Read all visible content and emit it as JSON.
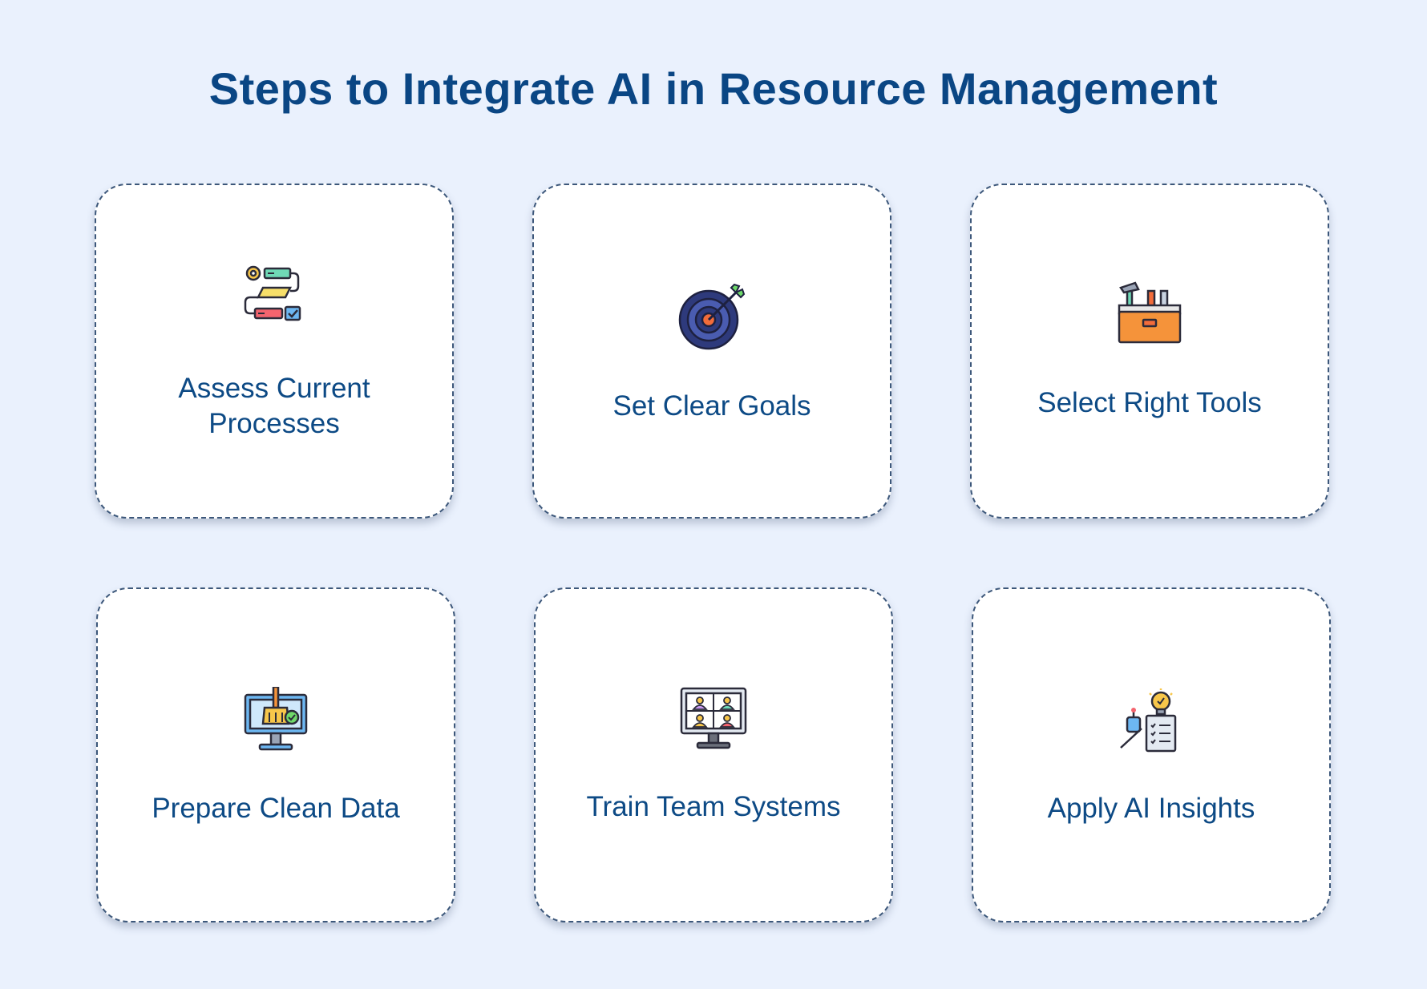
{
  "title": "Steps to Integrate AI in Resource Management",
  "colors": {
    "background": "#eaf1fd",
    "title": "#0a4684",
    "label": "#0d4a85",
    "card_border": "#3c577a"
  },
  "steps": [
    {
      "label": "Assess Current Processes",
      "icon": "process-flow-icon"
    },
    {
      "label": "Set Clear Goals",
      "icon": "target-icon"
    },
    {
      "label": "Select Right Tools",
      "icon": "toolbox-icon"
    },
    {
      "label": "Prepare Clean Data",
      "icon": "data-cleaning-monitor-icon"
    },
    {
      "label": "Train Team Systems",
      "icon": "video-team-monitor-icon"
    },
    {
      "label": "Apply AI Insights",
      "icon": "ai-insights-icon"
    }
  ]
}
